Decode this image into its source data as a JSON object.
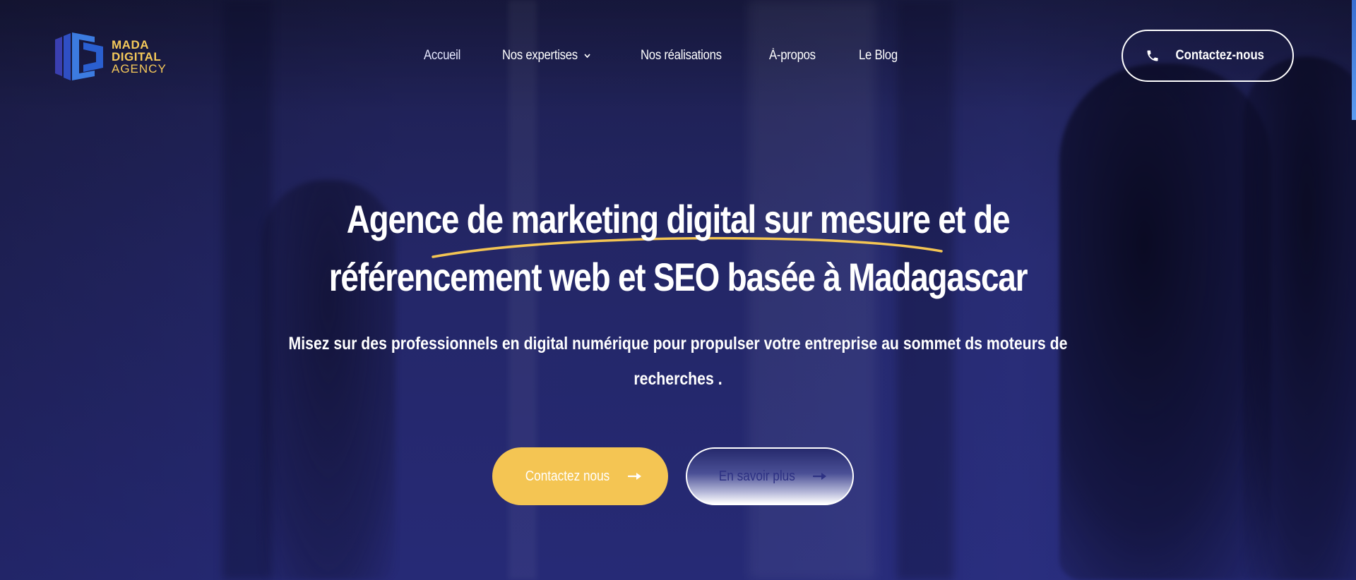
{
  "logo": {
    "line1": "MADA",
    "line2": "DIGITAL",
    "line3": "AGENCY",
    "colors": {
      "mark_dark": "#2c3a9a",
      "mark_light": "#3c7be0",
      "text": "#f5c95a"
    }
  },
  "nav": {
    "items": [
      {
        "label": "Accueil",
        "active": true
      },
      {
        "label": "Nos expertises",
        "has_dropdown": true,
        "icon": "chevron-down-icon"
      },
      {
        "label": "Nos réalisations"
      },
      {
        "label": "À-propos"
      },
      {
        "label": "Le Blog"
      }
    ]
  },
  "header_cta": {
    "label": "Contactez-nous",
    "icon": "phone-icon"
  },
  "hero": {
    "title_line1": "Agence de marketing digital sur mesure et de",
    "title_line2": "référencement web et SEO basée à Madagascar",
    "subtitle_line1": "Misez sur des professionnels en digital numérique pour propulser votre entreprise au sommet ds moteurs de",
    "subtitle_line2": "recherches .",
    "underline_color": "#f4c553"
  },
  "buttons": {
    "primary": {
      "label": "Contactez nous",
      "icon": "arrow-right-icon",
      "color": "#f4c553"
    },
    "secondary": {
      "label": "En savoir plus",
      "icon": "arrow-right-icon",
      "text_color": "#2d3183"
    }
  }
}
